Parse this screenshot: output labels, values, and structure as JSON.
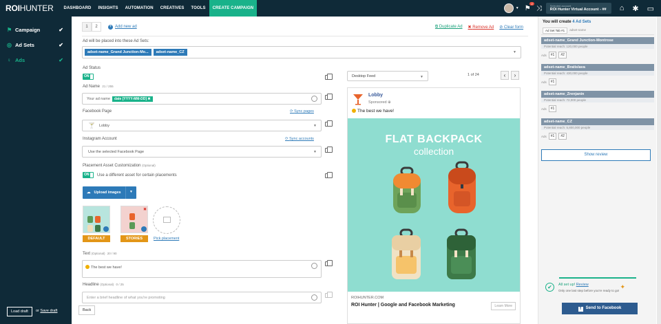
{
  "app": {
    "logo_bold": "ROI",
    "logo_rest": "HUNTER"
  },
  "nav": [
    "DASHBOARD",
    "INSIGHTS",
    "AUTOMATION",
    "CREATIVES",
    "TOOLS",
    "CREATE CAMPAIGN"
  ],
  "account": {
    "label": "Selected account",
    "name": "ROI Hunter Virtual Account - ##",
    "notifications": "2"
  },
  "sidebar": {
    "items": [
      {
        "label": "Campaign",
        "icon": "flag-icon"
      },
      {
        "label": "Ad Sets",
        "icon": "target-icon"
      },
      {
        "label": "Ads",
        "icon": "bulb-icon"
      }
    ],
    "load_draft": "Load draft",
    "or": "or",
    "save_draft": "Save draft"
  },
  "tabs": [
    "1",
    "2"
  ],
  "add_new_ad": "Add new ad",
  "actions": {
    "duplicate": "Duplicate Ad",
    "remove": "Remove Ad",
    "clear": "Clear form"
  },
  "form": {
    "adsets_label": "Ad will be placed into these Ad Sets:",
    "adsets": [
      "adset-name_Grand Junction-Mo...",
      "adset-name_CZ"
    ],
    "status_label": "Ad Status",
    "status_value": "ON",
    "adname_label": "Ad Name",
    "adname_count": "21 / 255",
    "adname_text": "Your ad name",
    "adname_chip": "date [YYYY-MM-DD]",
    "fbpage_label": "Facebook Page",
    "sync_pages": "Sync pages",
    "fbpage_value": "Lobby",
    "insta_label": "Instagram Account",
    "sync_accounts": "Sync accounts",
    "insta_value": "Use the selected Facebook Page",
    "placement_label": "Placement Asset Customization",
    "optional": "(Optional)",
    "placement_toggle": "ON",
    "placement_text": "Use a different asset for certain placements",
    "upload_label": "Upload images",
    "tag_default": "DEFAULT",
    "tag_stories": "STORIES",
    "pick_placement": "Pick placement",
    "text_label": "Text",
    "text_count": "20 / 90",
    "text_value": "The best we have!",
    "headline_label": "Headline",
    "headline_count": "0 / 25",
    "headline_placeholder": "Enter a brief headline of what you're promoting",
    "back": "Back"
  },
  "preview": {
    "feed": "Desktop Feed",
    "pager": "1 of 24",
    "page_name": "Lobby",
    "sponsored": "Sponsored",
    "text": "The best we have!",
    "image_title": "FLAT BACKPACK",
    "image_sub": "collection",
    "url": "ROIHUNTER.COM",
    "headline": "ROI Hunter | Google and Facebook Marketing",
    "cta": "Learn More",
    "bg_color": "#8fddd0"
  },
  "right": {
    "title_pre": "You will create",
    "title_count": "4 Ad Sets",
    "tab1": "Ad Set Tab #1",
    "tab2": "adset-name",
    "groups": [
      {
        "name": "adset-name_Grand Junction-Montrose",
        "reach": "Potential reach: 120,000 people",
        "ads": [
          "#1",
          "#2"
        ]
      },
      {
        "name": "adset-name_Bratislava",
        "reach": "Potential reach: 430,000 people",
        "ads": [
          "#1"
        ]
      },
      {
        "name": "adset-name_Zrenjanin",
        "reach": "Potential reach: 72,000 people",
        "ads": [
          "#1"
        ]
      },
      {
        "name": "adset-name_CZ",
        "reach": "Potential reach: 5,800,000 people",
        "ads": [
          "#1",
          "#2"
        ]
      }
    ],
    "ads_label": "Ads",
    "show_review": "Show review",
    "ready_title": "All set up!",
    "ready_link": "Review",
    "ready_desc": "Only one last step before you're ready to go!",
    "send": "Send to Facebook"
  }
}
